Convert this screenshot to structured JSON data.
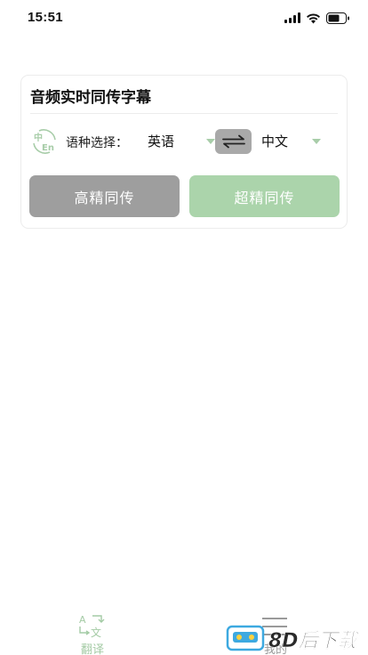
{
  "status_bar": {
    "time": "15:51"
  },
  "card": {
    "title": "音频实时同传字幕",
    "lang_label": "语种选择：",
    "source_language": "英语",
    "target_language": "中文",
    "lang_icon_top": "中",
    "lang_icon_bottom": "En",
    "buttons": {
      "high_precision": "高精同传",
      "super_precision": "超精同传"
    }
  },
  "tabbar": {
    "tabs": [
      {
        "label": "翻译",
        "active": true
      },
      {
        "label": "我的",
        "active": false
      }
    ]
  },
  "watermark": {
    "text": "8D后下载"
  },
  "colors": {
    "accent_green": "#a8cda9",
    "gray_button": "#9e9e9e",
    "swap_bg": "#a9a9a9"
  }
}
